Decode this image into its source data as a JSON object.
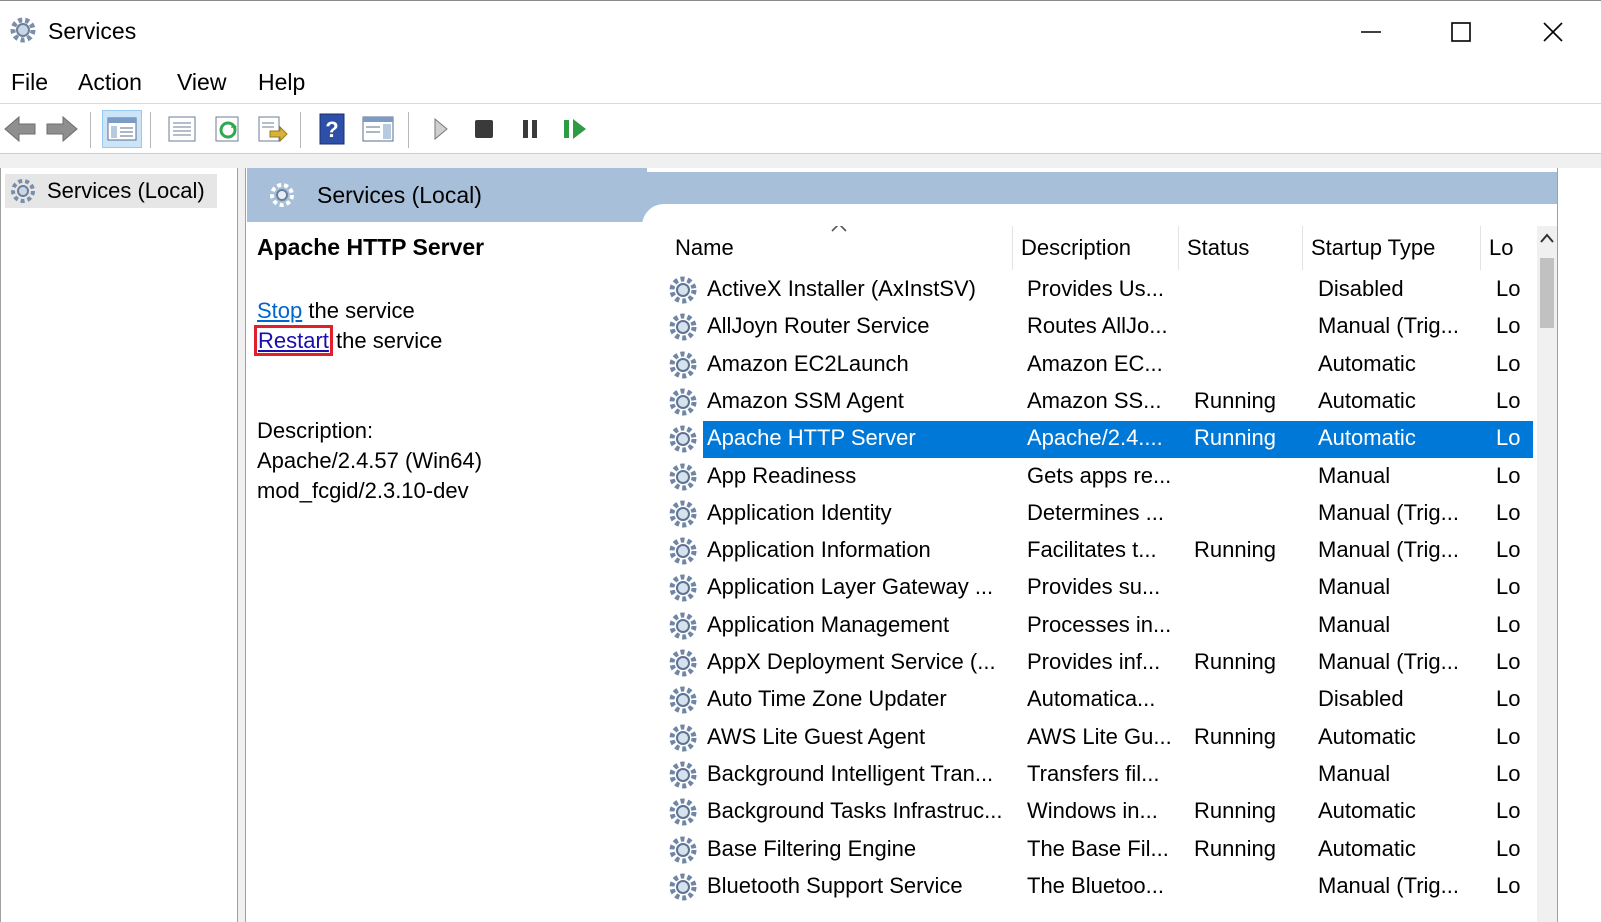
{
  "window": {
    "title": "Services",
    "controls": {
      "minimize": "—",
      "maximize": "☐",
      "close": "✕"
    }
  },
  "menu": [
    "File",
    "Action",
    "View",
    "Help"
  ],
  "toolbar": {
    "buttons": [
      "back-icon",
      "forward-icon",
      "show-hide-console-tree-icon",
      "properties-icon",
      "refresh-icon",
      "export-list-icon",
      "help-icon",
      "show-action-pane-icon",
      "start-service-icon",
      "stop-service-icon",
      "pause-service-icon",
      "resume-service-icon"
    ]
  },
  "tree": {
    "root_label": "Services (Local)"
  },
  "main": {
    "header_label": "Services (Local)",
    "selected_service": "Apache HTTP Server",
    "actions": [
      {
        "link": "Stop",
        "rest": " the service"
      },
      {
        "link": "Restart",
        "rest": " the service"
      }
    ],
    "description_label": "Description:",
    "description_lines": [
      "Apache/2.4.57 (Win64)",
      "mod_fcgid/2.3.10-dev"
    ]
  },
  "columns": [
    "Name",
    "Description",
    "Status",
    "Startup Type",
    "Lo"
  ],
  "rows": [
    {
      "name": "ActiveX Installer (AxInstSV)",
      "description": "Provides Us...",
      "status": "",
      "startup": "Disabled",
      "logon": "Lo"
    },
    {
      "name": "AllJoyn Router Service",
      "description": "Routes AllJo...",
      "status": "",
      "startup": "Manual (Trig...",
      "logon": "Lo"
    },
    {
      "name": "Amazon EC2Launch",
      "description": "Amazon EC...",
      "status": "",
      "startup": "Automatic",
      "logon": "Lo"
    },
    {
      "name": "Amazon SSM Agent",
      "description": "Amazon SS...",
      "status": "Running",
      "startup": "Automatic",
      "logon": "Lo"
    },
    {
      "name": "Apache HTTP Server",
      "description": "Apache/2.4....",
      "status": "Running",
      "startup": "Automatic",
      "logon": "Lo",
      "selected": true
    },
    {
      "name": "App Readiness",
      "description": "Gets apps re...",
      "status": "",
      "startup": "Manual",
      "logon": "Lo"
    },
    {
      "name": "Application Identity",
      "description": "Determines ...",
      "status": "",
      "startup": "Manual (Trig...",
      "logon": "Lo"
    },
    {
      "name": "Application Information",
      "description": "Facilitates t...",
      "status": "Running",
      "startup": "Manual (Trig...",
      "logon": "Lo"
    },
    {
      "name": "Application Layer Gateway ...",
      "description": "Provides su...",
      "status": "",
      "startup": "Manual",
      "logon": "Lo"
    },
    {
      "name": "Application Management",
      "description": "Processes in...",
      "status": "",
      "startup": "Manual",
      "logon": "Lo"
    },
    {
      "name": "AppX Deployment Service (...",
      "description": "Provides inf...",
      "status": "Running",
      "startup": "Manual (Trig...",
      "logon": "Lo"
    },
    {
      "name": "Auto Time Zone Updater",
      "description": "Automatica...",
      "status": "",
      "startup": "Disabled",
      "logon": "Lo"
    },
    {
      "name": "AWS Lite Guest Agent",
      "description": "AWS Lite Gu...",
      "status": "Running",
      "startup": "Automatic",
      "logon": "Lo"
    },
    {
      "name": "Background Intelligent Tran...",
      "description": "Transfers fil...",
      "status": "",
      "startup": "Manual",
      "logon": "Lo"
    },
    {
      "name": "Background Tasks Infrastruc...",
      "description": "Windows in...",
      "status": "Running",
      "startup": "Automatic",
      "logon": "Lo"
    },
    {
      "name": "Base Filtering Engine",
      "description": "The Base Fil...",
      "status": "Running",
      "startup": "Automatic",
      "logon": "Lo"
    },
    {
      "name": "Bluetooth Support Service",
      "description": "The Bluetoo...",
      "status": "",
      "startup": "Manual (Trig...",
      "logon": "Lo"
    }
  ],
  "colors": {
    "selection": "#0078d7",
    "header_band": "#a7bfd8",
    "link": "#0066cc",
    "highlight_box": "#e0202a"
  }
}
